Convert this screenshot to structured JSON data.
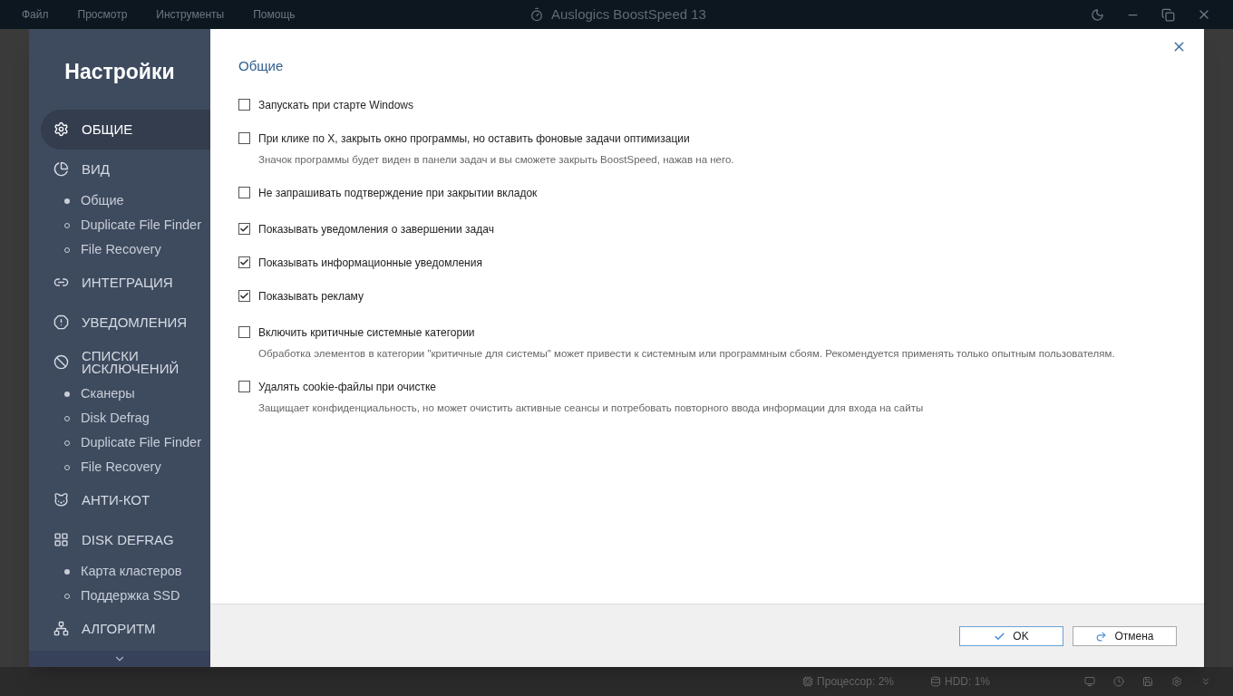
{
  "app": {
    "title": "Auslogics BoostSpeed 13",
    "menu": [
      "Файл",
      "Просмотр",
      "Инструменты",
      "Помощь"
    ]
  },
  "dialog": {
    "title": "Настройки",
    "heading": "Общие",
    "sidebar": [
      {
        "kind": "section",
        "label": "ОБЩИЕ",
        "selected": true
      },
      {
        "kind": "section",
        "label": "ВИД",
        "selected": false
      },
      {
        "kind": "sub",
        "label": "Общие",
        "selected": true
      },
      {
        "kind": "sub",
        "label": "Duplicate File Finder",
        "selected": false
      },
      {
        "kind": "sub",
        "label": "File Recovery",
        "selected": false
      },
      {
        "kind": "section",
        "label": "ИНТЕГРАЦИЯ",
        "selected": false
      },
      {
        "kind": "section",
        "label": "УВЕДОМЛЕНИЯ",
        "selected": false
      },
      {
        "kind": "section",
        "label": "СПИСКИ ИСКЛЮЧЕНИЙ",
        "selected": false
      },
      {
        "kind": "sub",
        "label": "Сканеры",
        "selected": true
      },
      {
        "kind": "sub",
        "label": "Disk Defrag",
        "selected": false
      },
      {
        "kind": "sub",
        "label": "Duplicate File Finder",
        "selected": false
      },
      {
        "kind": "sub",
        "label": "File Recovery",
        "selected": false
      },
      {
        "kind": "section",
        "label": "АНТИ-КОТ",
        "selected": false
      },
      {
        "kind": "section",
        "label": "DISK DEFRAG",
        "selected": false
      },
      {
        "kind": "sub",
        "label": "Карта кластеров",
        "selected": true
      },
      {
        "kind": "sub",
        "label": "Поддержка SSD",
        "selected": false
      },
      {
        "kind": "section",
        "label": "АЛГОРИТМ",
        "selected": false
      }
    ],
    "option_groups": [
      [
        {
          "label": "Запускать при старте Windows",
          "checked": false
        },
        {
          "label": "При клике по X, закрыть окно программы, но оставить фоновые задачи оптимизации",
          "hint": "Значок программы будет виден в панели задач и вы сможете закрыть BoostSpeed, нажав на него.",
          "checked": false
        },
        {
          "label": "Не запрашивать подтверждение при закрытии вкладок",
          "checked": false
        }
      ],
      [
        {
          "label": "Показывать уведомления о завершении задач",
          "checked": true
        },
        {
          "label": "Показывать информационные уведомления",
          "checked": true
        },
        {
          "label": "Показывать рекламу",
          "checked": true
        }
      ],
      [
        {
          "label": "Включить критичные системные категории",
          "hint": "Обработка элементов в категории \"критичные для системы\" может привести к системным или программным сбоям. Рекомендуется применять только опытным пользователям.",
          "checked": false
        },
        {
          "label": "Удалять cookie-файлы при очистке",
          "hint": "Защищает конфиденциальность, но может очистить активные сеансы и потребовать повторного ввода информации для входа на сайты",
          "checked": false
        }
      ]
    ],
    "buttons": [
      {
        "kind": "ok",
        "label": "OK"
      },
      {
        "kind": "cancel",
        "label": "Отмена"
      }
    ]
  },
  "status_bar": {
    "cpu": "Процессор: 2%",
    "hdd": "HDD: 1%"
  }
}
